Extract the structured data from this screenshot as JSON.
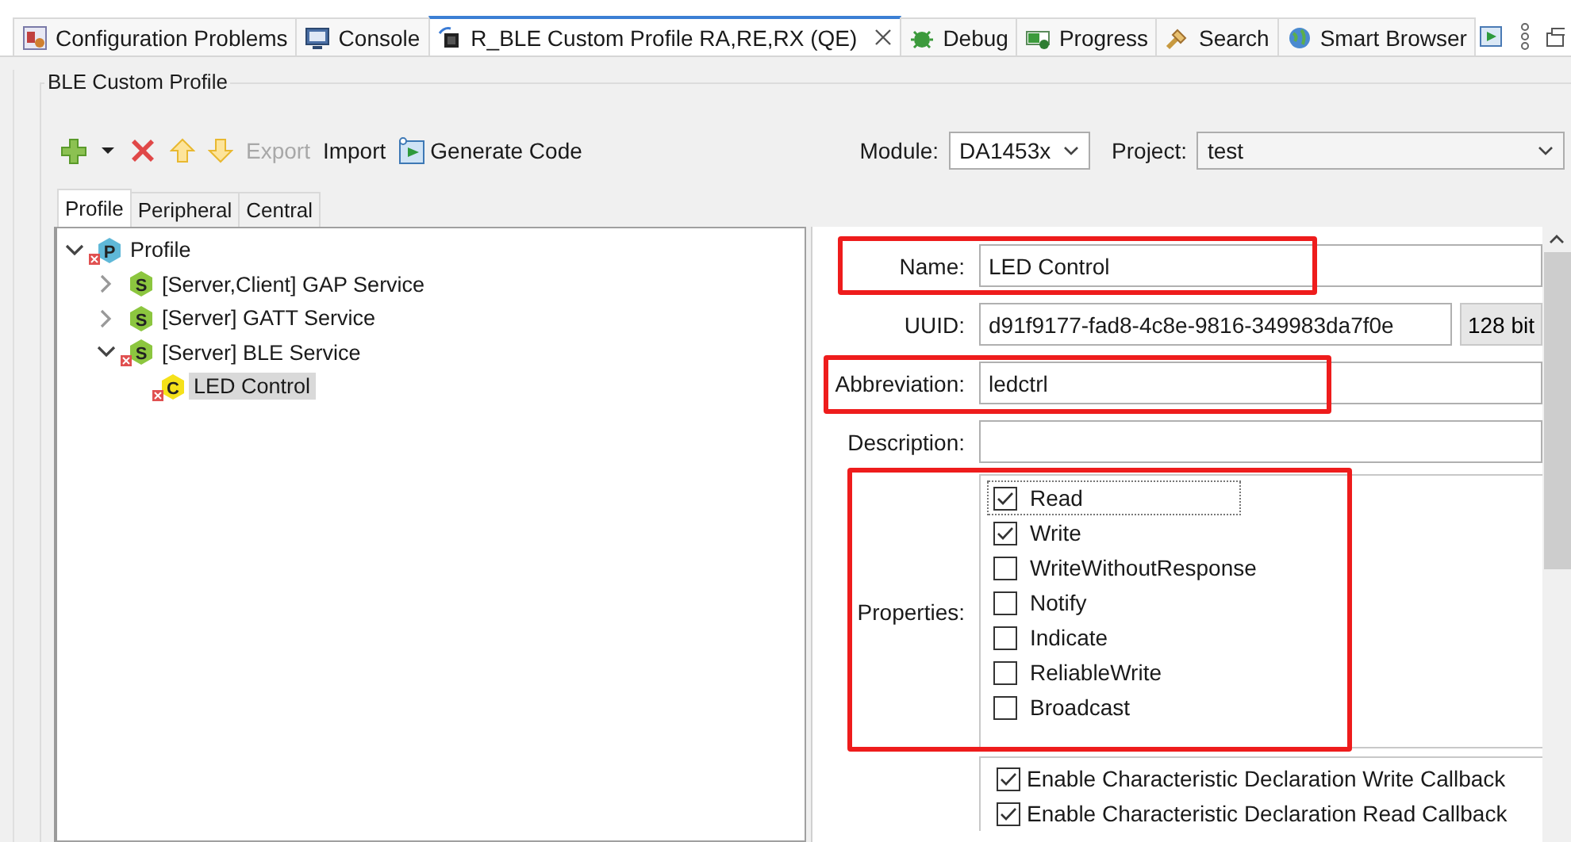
{
  "view_tabs": [
    {
      "label": "Configuration Problems",
      "kind": "problems",
      "selected": false,
      "closable": false
    },
    {
      "label": "Console",
      "kind": "console",
      "selected": false,
      "closable": false
    },
    {
      "label": "R_BLE Custom Profile RA,RE,RX (QE)",
      "kind": "chip",
      "selected": true,
      "closable": true
    },
    {
      "label": "Debug",
      "kind": "debug",
      "selected": false,
      "closable": false
    },
    {
      "label": "Progress",
      "kind": "progress",
      "selected": false,
      "closable": false
    },
    {
      "label": "Search",
      "kind": "search",
      "selected": false,
      "closable": false
    },
    {
      "label": "Smart Browser",
      "kind": "browser",
      "selected": false,
      "closable": false
    }
  ],
  "group_title": "BLE Custom Profile",
  "toolbar": [
    {
      "kind": "add",
      "disabled": false
    },
    {
      "kind": "dropdown",
      "disabled": false
    },
    {
      "kind": "delete",
      "disabled": false
    },
    {
      "kind": "up",
      "disabled": false
    },
    {
      "kind": "down",
      "disabled": false
    },
    {
      "kind": "text",
      "label": "Export",
      "disabled": true
    },
    {
      "kind": "text",
      "label": "Import",
      "disabled": false
    },
    {
      "kind": "generate",
      "label": "Generate Code",
      "disabled": false
    }
  ],
  "module": {
    "label": "Module:",
    "value": "DA1453x"
  },
  "project": {
    "label": "Project:",
    "value": "test"
  },
  "editor_tabs": [
    {
      "label": "Profile",
      "selected": true
    },
    {
      "label": "Peripheral",
      "selected": false
    },
    {
      "label": "Central",
      "selected": false
    }
  ],
  "tree": [
    {
      "label": "Profile",
      "badge": "P",
      "error": true,
      "expanded": true,
      "selected": false,
      "children": [
        {
          "label": "[Server,Client] GAP Service",
          "badge": "S",
          "error": false,
          "expanded": false,
          "selected": false
        },
        {
          "label": "[Server] GATT Service",
          "badge": "S",
          "error": false,
          "expanded": false,
          "selected": false
        },
        {
          "label": "[Server] BLE Service",
          "badge": "S",
          "error": true,
          "expanded": true,
          "selected": false,
          "children": [
            {
              "label": "LED Control",
              "badge": "C",
              "error": true,
              "selected": true
            }
          ]
        }
      ]
    }
  ],
  "form": {
    "name": {
      "label": "Name:",
      "value": "LED Control",
      "highlighted": true
    },
    "uuid": {
      "label": "UUID:",
      "value": "d91f9177-fad8-4c8e-9816-349983da7f0e",
      "button": "128 bit"
    },
    "abbreviation": {
      "label": "Abbreviation:",
      "value": "ledctrl",
      "highlighted": true
    },
    "description": {
      "label": "Description:"
    },
    "properties": {
      "label": "Properties:",
      "highlighted": true,
      "items": [
        {
          "label": "Read",
          "checked": true,
          "focused": true
        },
        {
          "label": "Write",
          "checked": true,
          "focused": false
        },
        {
          "label": "WriteWithoutResponse",
          "checked": false,
          "focused": false
        },
        {
          "label": "Notify",
          "checked": false,
          "focused": false
        },
        {
          "label": "Indicate",
          "checked": false,
          "focused": false
        },
        {
          "label": "ReliableWrite",
          "checked": false,
          "focused": false
        },
        {
          "label": "Broadcast",
          "checked": false,
          "focused": false
        }
      ]
    },
    "callbacks": [
      {
        "label": "Enable Characteristic Declaration Write Callback",
        "checked": true
      },
      {
        "label": "Enable Characteristic Declaration Read Callback",
        "checked": true
      }
    ]
  }
}
